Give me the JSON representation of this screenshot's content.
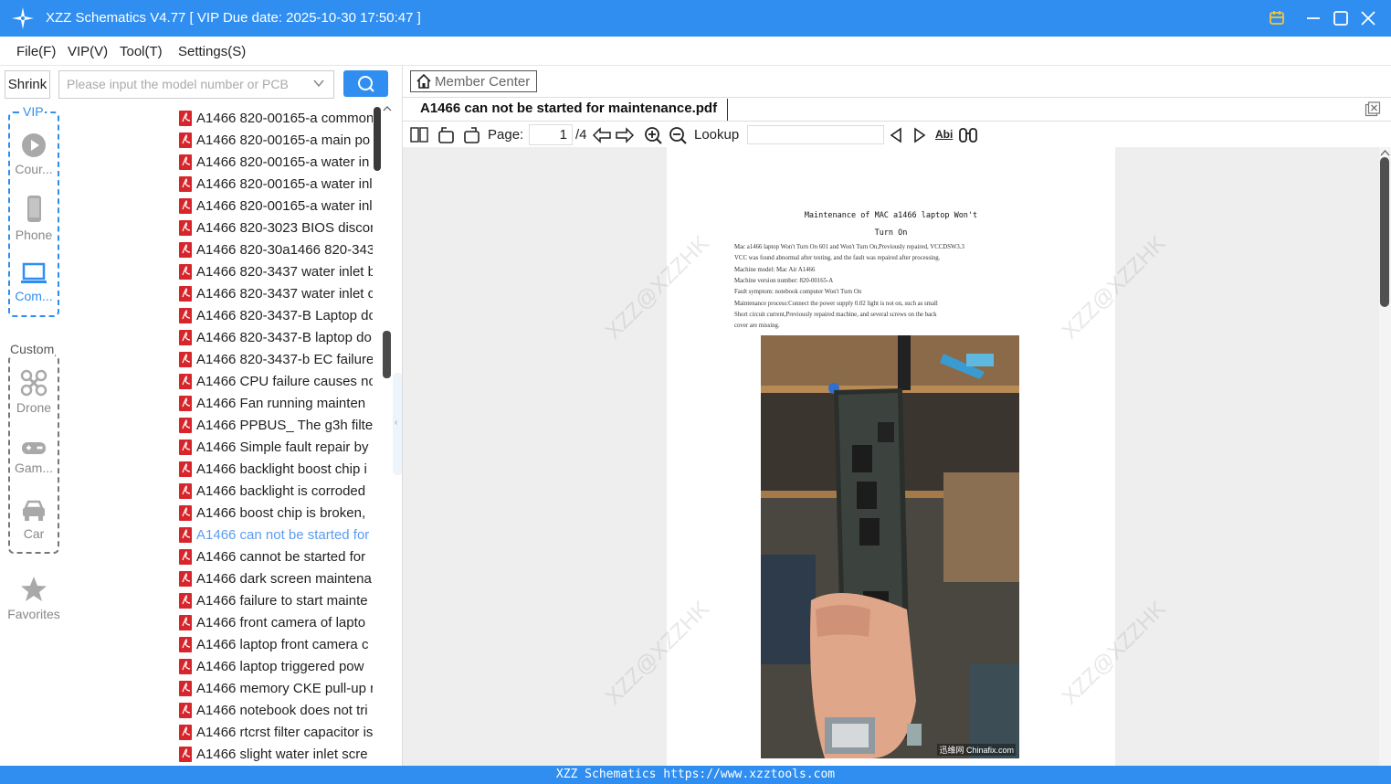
{
  "window": {
    "title": "XZZ Schematics V4.77 [ VIP Due date: 2025-10-30 17:50:47 ]"
  },
  "menu": [
    "File(F)",
    "VIP(V)",
    "Tool(T)",
    "Settings(S)"
  ],
  "search": {
    "shrink_label": "Shrink",
    "placeholder": "Please input the model number or PCB"
  },
  "categories": {
    "vip_label": "VIP",
    "custom_label": "Custom",
    "vip_items": [
      {
        "label": "Cour...",
        "icon": "play-icon"
      },
      {
        "label": "Phone",
        "icon": "phone-icon"
      },
      {
        "label": "Com...",
        "icon": "laptop-icon"
      }
    ],
    "custom_items": [
      {
        "label": "Drone",
        "icon": "drone-icon"
      },
      {
        "label": "Gam...",
        "icon": "gamepad-icon"
      },
      {
        "label": "Car",
        "icon": "car-icon"
      }
    ],
    "favorites_label": "Favorites"
  },
  "files": [
    "A1466 820-00165-a common",
    "A1466 820-00165-a main po",
    "A1466 820-00165-a water in",
    "A1466 820-00165-a water inl",
    "A1466 820-00165-a water inl",
    "A1466 820-3023 BIOS discon",
    "A1466 820-30a1466 820-343",
    "A1466 820-3437 water inlet b",
    "A1466 820-3437 water inlet c",
    "A1466 820-3437-B Laptop do",
    "A1466 820-3437-B laptop do",
    "A1466 820-3437-b EC failure",
    "A1466 CPU failure causes no",
    "A1466 Fan running mainten",
    "A1466 PPBUS_ The g3h filter",
    "A1466 Simple fault repair by",
    "A1466 backlight boost chip i",
    "A1466 backlight is corroded",
    "A1466 boost chip is broken,",
    "A1466 can not be started for",
    "A1466 cannot be started for",
    "A1466 dark screen maintena",
    "A1466 failure to start mainte",
    "A1466 front camera of lapto",
    "A1466 laptop front camera c",
    "A1466 laptop triggered pow",
    "A1466 memory CKE pull-up r",
    "A1466 notebook does not tri",
    "A1466 rtcrst filter capacitor is",
    "A1466 slight water inlet scre"
  ],
  "selected_file_index": 19,
  "viewer": {
    "member_center": "Member Center",
    "tab_title": "A1466 can not be started for maintenance.pdf",
    "page_label": "Page:",
    "page_current": "1",
    "page_total": "/4",
    "lookup_label": "Lookup",
    "abi_label": "Abi"
  },
  "document": {
    "title_line1": "Maintenance of MAC a1466 laptop Won't",
    "title_line2": "Turn On",
    "lines": [
      "Mac a1466 laptop Won't Turn On 601 and Won't Turn On,Previously repaired, VCCDSW3.3",
      "VCC was found abnormal after testing, and the fault was repaired after processing.",
      "Machine model: Mac Air A1466",
      "Machine version number: 820-00165-A",
      "Fault symptom: notebook computer Won't Turn On",
      "Maintenance process:Connect the power supply 0.02 light is not on, such as small",
      "Short circuit current,Previously repaired machine, and several screws on the back",
      "cover are missing."
    ],
    "photo_credit": "迅维网 Chinafix.com",
    "watermark": "XZZ@XZZHK"
  },
  "status": {
    "text": "XZZ Schematics https://www.xzztools.com"
  },
  "colors": {
    "accent": "#2f8ef0",
    "selected_file": "#5b9cf0",
    "pdf_icon": "#d7262b"
  }
}
